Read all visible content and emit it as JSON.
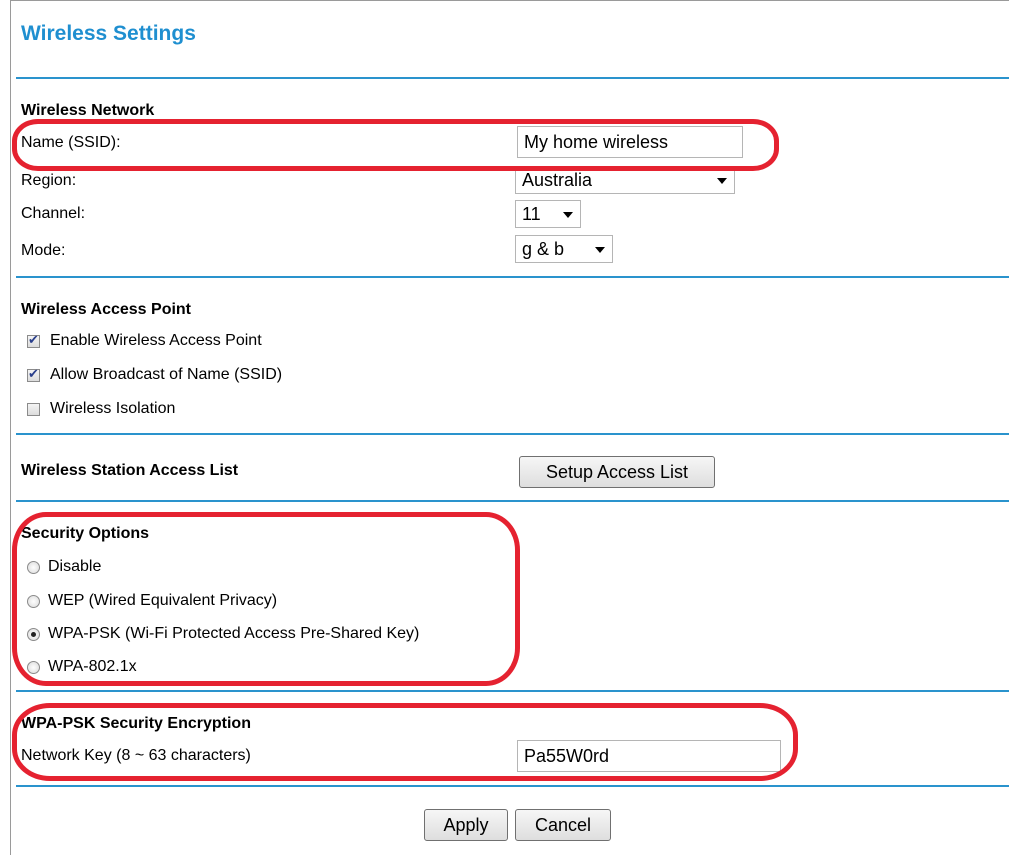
{
  "page": {
    "title": "Wireless Settings"
  },
  "wireless_network": {
    "heading": "Wireless Network",
    "ssid_label": "Name (SSID):",
    "ssid_value": "My home wireless",
    "region_label": "Region:",
    "region_value": "Australia",
    "channel_label": "Channel:",
    "channel_value": "11",
    "mode_label": "Mode:",
    "mode_value": "g & b"
  },
  "access_point": {
    "heading": "Wireless Access Point",
    "options": [
      {
        "label": "Enable Wireless Access Point",
        "checked": true
      },
      {
        "label": "Allow Broadcast of Name (SSID)",
        "checked": true
      },
      {
        "label": "Wireless Isolation",
        "checked": false
      }
    ]
  },
  "station_access": {
    "heading": "Wireless Station Access List",
    "button_label": "Setup Access List"
  },
  "security": {
    "heading": "Security Options",
    "options": [
      {
        "label": "Disable",
        "selected": false
      },
      {
        "label": "WEP (Wired Equivalent Privacy)",
        "selected": false
      },
      {
        "label": "WPA-PSK (Wi-Fi Protected Access Pre-Shared Key)",
        "selected": true
      },
      {
        "label": "WPA-802.1x",
        "selected": false
      }
    ]
  },
  "encryption": {
    "heading": "WPA-PSK Security Encryption",
    "key_label": "Network Key (8 ~ 63 characters)",
    "key_value": "Pa55W0rd"
  },
  "actions": {
    "apply_label": "Apply",
    "cancel_label": "Cancel"
  },
  "colors": {
    "accent": "#1f8fd0",
    "rule": "#2a93cd",
    "highlight": "#e52230"
  }
}
